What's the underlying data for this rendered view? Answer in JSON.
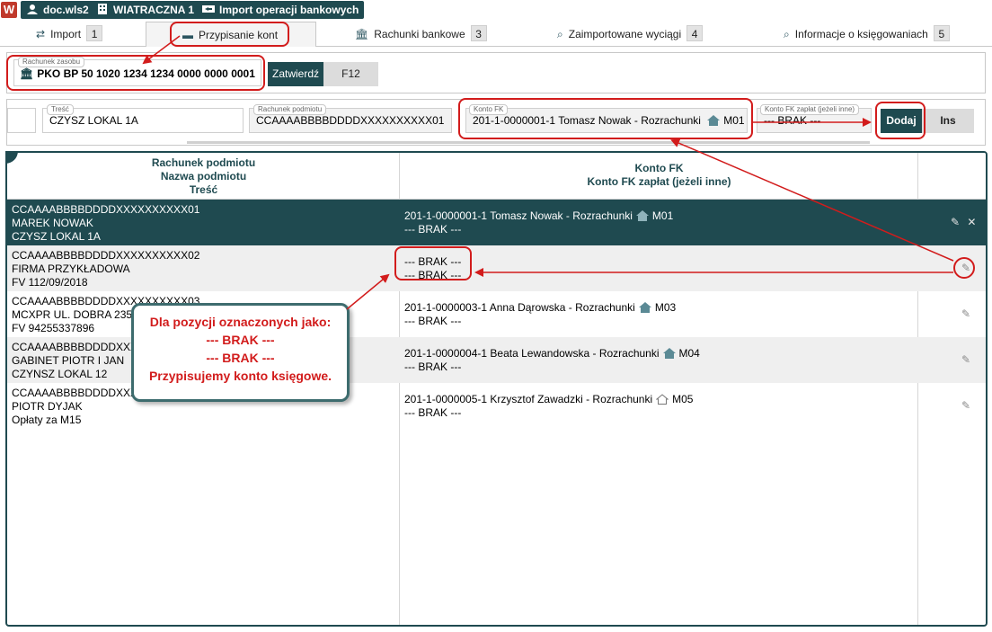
{
  "topbar": {
    "logo": "W",
    "chips": [
      {
        "label": "doc.wls2"
      },
      {
        "label": "WIATRACZNA 1"
      },
      {
        "label": "Import operacji bankowych"
      }
    ]
  },
  "tabs": [
    {
      "label": "Import",
      "num": "1"
    },
    {
      "label": "Przypisanie kont",
      "num": ""
    },
    {
      "label": "Rachunki bankowe",
      "num": "3"
    },
    {
      "label": "Zaimportowane wyciągi",
      "num": "4"
    },
    {
      "label": "Informacje o księgowaniach",
      "num": "5"
    }
  ],
  "resource": {
    "label": "Rachunek zasobu",
    "value": "PKO BP 50 1020 1234 1234 0000 0000 0001",
    "confirm_label": "Zatwierdź",
    "confirm_key": "F12"
  },
  "form": {
    "tresc_label": "Treść",
    "tresc_value": "CZYSZ LOKAL 1A",
    "rachunek_label": "Rachunek podmiotu",
    "rachunek_value": "CCAAAABBBBDDDDXXXXXXXXXX01",
    "konto_fk_label": "Konto FK",
    "konto_fk_value": "201-1-0000001-1 Tomasz Nowak - Rozrachunki",
    "konto_fk_code": "M01",
    "konto_zaplat_label": "Konto FK zapłat (jeżeli inne)",
    "konto_zaplat_value": "--- BRAK ---",
    "add_label": "Dodaj",
    "add_key": "Ins"
  },
  "table": {
    "header_col1": [
      "Rachunek podmiotu",
      "Nazwa podmiotu",
      "Treść"
    ],
    "header_col2": [
      "Konto FK",
      "Konto FK zapłat (jeżeli inne)"
    ],
    "rows": [
      {
        "account": "CCAAAABBBBDDDDXXXXXXXXXX01",
        "name": "MAREK NOWAK",
        "text": "CZYSZ LOKAL 1A",
        "fk": "201-1-0000001-1 Tomasz Nowak - Rozrachunki",
        "fk_code": "M01",
        "fk_pay": "--- BRAK ---",
        "home": true
      },
      {
        "account": "CCAAAABBBBDDDDXXXXXXXXXX02",
        "name": "FIRMA PRZYKŁADOWA",
        "text": "FV 112/09/2018",
        "fk": "--- BRAK ---",
        "fk_code": "",
        "fk_pay": "--- BRAK ---",
        "home": false
      },
      {
        "account": "CCAAAABBBBDDDDXXXXXXXXXX03",
        "name": "MCXPR UL. DOBRA 235",
        "text": "FV 94255337896",
        "fk": "201-1-0000003-1 Anna Dąrowska - Rozrachunki",
        "fk_code": "M03",
        "fk_pay": "--- BRAK ---",
        "home": true
      },
      {
        "account": "CCAAAABBBBDDDDXXXXXXXXXX04",
        "name": "GABINET PIOTR I JAN",
        "text": "CZYNSZ LOKAL 12",
        "fk": "201-1-0000004-1 Beata Lewandowska - Rozrachunki",
        "fk_code": "M04",
        "fk_pay": "--- BRAK ---",
        "home": true
      },
      {
        "account": "CCAAAABBBBDDDDXXXXXXXXXX05",
        "name": "PIOTR DYJAK",
        "text": "Opłaty za M15",
        "fk": "201-1-0000005-1 Krzysztof Zawadzki - Rozrachunki",
        "fk_code": "M05",
        "fk_pay": "--- BRAK ---",
        "home": true
      }
    ]
  },
  "callout": {
    "lines": [
      "Dla pozycji oznaczonych jako:",
      "--- BRAK ---",
      "--- BRAK ---",
      "Przypisujemy konto księgowe."
    ]
  },
  "colors": {
    "accent": "#1f4a50",
    "annotation_red": "#d21c1c",
    "row_alt": "#efefef"
  }
}
